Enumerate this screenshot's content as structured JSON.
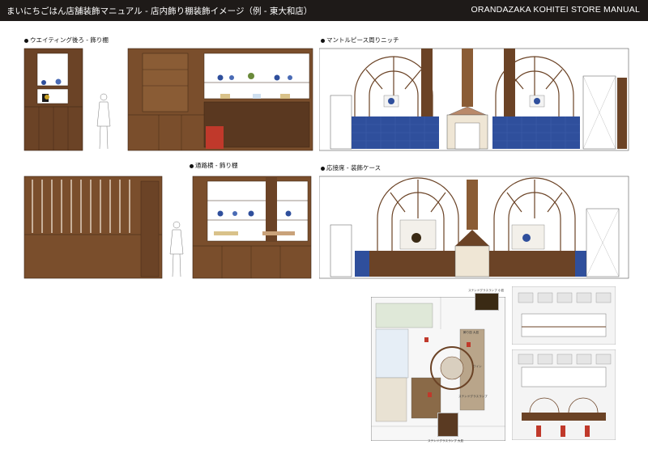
{
  "header": {
    "title": "まいにちごはん店舗装飾マニュアル - 店内飾り棚装飾イメージ（例 - 東大和店）",
    "manual": "ORANDAZAKA KOHITEI STORE MANUAL"
  },
  "sections": {
    "waiting": "ウエイティング後ろ - 飾り棚",
    "mantel": "マントルピース周りニッチ",
    "aisle": "通路横 - 飾り棚",
    "reception": "応接席 - 装飾ケース"
  },
  "plan_notes": [
    "ステンドグラスランプ 小皿",
    "飾り皿 大皿",
    "ワイン",
    "ステンドグラスランプ",
    "ステンドグラスランプ 大皿"
  ],
  "colors": {
    "header_bg": "#1e1a18",
    "wood": "#6b4326",
    "wood_dark": "#4e2f18",
    "tile": "#2f4f9c"
  }
}
